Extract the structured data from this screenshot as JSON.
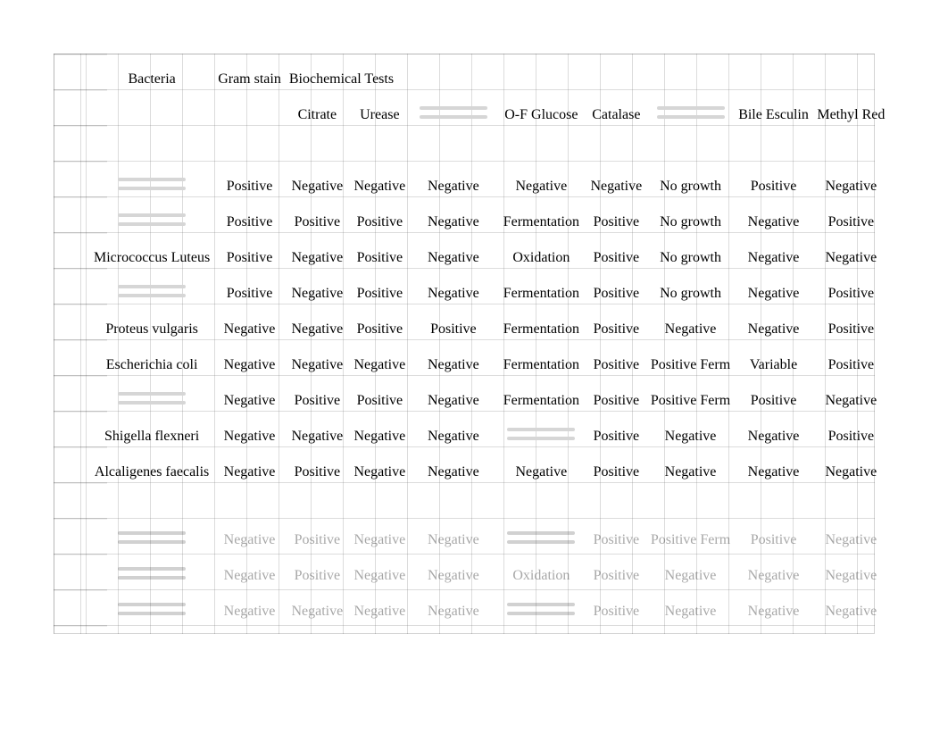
{
  "header": {
    "bacteria": "Bacteria",
    "gram_stain": "Gram stain",
    "biochemical_tests": "Biochemical Tests",
    "citrate": "Citrate",
    "urease": "Urease",
    "of_glucose": "O-F Glucose",
    "catalase": "Catalase",
    "bile_esculin": "Bile Esculin",
    "methyl_red": "Methyl Red"
  },
  "columns_obscured": {
    "col4_label_obscured": true,
    "col7_label_obscured": true
  },
  "rows": [
    {
      "bacteria_obscured": true,
      "bacteria": "",
      "gram": "Positive",
      "citrate": "Negative",
      "urease": "Negative",
      "col4": "Negative",
      "of_glucose": "Negative",
      "catalase": "Negative",
      "col7": "No growth",
      "bile": "Positive",
      "mr": "Negative"
    },
    {
      "bacteria_obscured": true,
      "bacteria": "",
      "gram": "Positive",
      "citrate": "Positive",
      "urease": "Positive",
      "col4": "Negative",
      "of_glucose": "Fermentation",
      "catalase": "Positive",
      "col7": "No growth",
      "bile": "Negative",
      "mr": "Positive"
    },
    {
      "bacteria_obscured": false,
      "bacteria": "Micrococcus Luteus",
      "gram": "Positive",
      "citrate": "Negative",
      "urease": "Positive",
      "col4": "Negative",
      "of_glucose": "Oxidation",
      "catalase": "Positive",
      "col7": "No growth",
      "bile": "Negative",
      "mr": "Negative"
    },
    {
      "bacteria_obscured": true,
      "bacteria": "",
      "gram": "Positive",
      "citrate": "Negative",
      "urease": "Positive",
      "col4": "Negative",
      "of_glucose": "Fermentation",
      "catalase": "Positive",
      "col7": "No growth",
      "bile": "Negative",
      "mr": "Positive"
    },
    {
      "bacteria_obscured": false,
      "bacteria": "Proteus vulgaris",
      "gram": "Negative",
      "citrate": "Negative",
      "urease": "Positive",
      "col4": "Positive",
      "of_glucose": "Fermentation",
      "catalase": "Positive",
      "col7": "Negative",
      "bile": "Negative",
      "mr": "Positive"
    },
    {
      "bacteria_obscured": false,
      "bacteria": "Escherichia coli",
      "gram": "Negative",
      "citrate": "Negative",
      "urease": "Negative",
      "col4": "Negative",
      "of_glucose": "Fermentation",
      "catalase": "Positive",
      "col7": "Positive Ferm",
      "bile": "Variable",
      "mr": "Positive"
    },
    {
      "bacteria_obscured": true,
      "bacteria": "",
      "gram": "Negative",
      "citrate": "Positive",
      "urease": "Positive",
      "col4": "Negative",
      "of_glucose": "Fermentation",
      "catalase": "Positive",
      "col7": "Positive Ferm",
      "bile": "Positive",
      "mr": "Negative"
    },
    {
      "bacteria_obscured": false,
      "bacteria": "Shigella flexneri",
      "gram": "Negative",
      "citrate": "Negative",
      "urease": "Negative",
      "col4": "Negative",
      "of_glucose": "",
      "of_glucose_obscured": true,
      "catalase": "Positive",
      "col7": "Negative",
      "bile": "Negative",
      "mr": "Positive"
    },
    {
      "bacteria_obscured": false,
      "bacteria": "Alcaligenes faecalis",
      "gram": "Negative",
      "citrate": "Positive",
      "urease": "Negative",
      "col4": "Negative",
      "of_glucose": "Negative",
      "catalase": "Positive",
      "col7": "Negative",
      "bile": "Negative",
      "mr": "Negative"
    }
  ],
  "faded_rows": [
    {
      "bacteria_obscured": true,
      "gram": "Negative",
      "citrate": "Positive",
      "urease": "Negative",
      "col4": "Negative",
      "of_glucose_obscured": true,
      "catalase": "Positive",
      "col7": "Positive Ferm",
      "bile": "Positive",
      "mr": "Negative"
    },
    {
      "bacteria_obscured": true,
      "gram": "Negative",
      "citrate": "Positive",
      "urease": "Negative",
      "col4": "Negative",
      "of_glucose": "Oxidation",
      "catalase": "Positive",
      "col7": "Negative",
      "bile": "Negative",
      "mr": "Negative"
    },
    {
      "bacteria_obscured": true,
      "gram": "Negative",
      "citrate": "Negative",
      "urease": "Negative",
      "col4": "Negative",
      "of_glucose_obscured": true,
      "catalase": "Positive",
      "col7": "Negative",
      "bile": "Negative",
      "mr": "Negative"
    }
  ]
}
